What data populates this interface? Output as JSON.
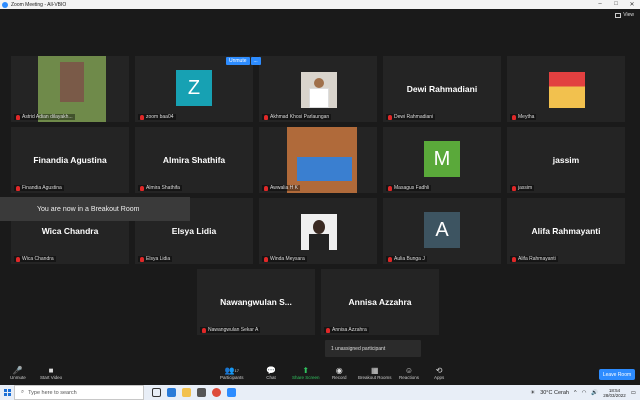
{
  "window": {
    "title": "Zoom Meeting - All-VBIO"
  },
  "view_label": "View",
  "unmute_pill": {
    "label": "Unmute",
    "more": "..."
  },
  "tiles": [
    {
      "id": "astrid",
      "caption": "Astrid Adian dilayakh...",
      "kind": "photo",
      "photo_color": "#6f8a4a"
    },
    {
      "id": "zoom",
      "caption": "zoom baa04",
      "kind": "avatar",
      "letter": "Z",
      "color": "#17a1b3"
    },
    {
      "id": "akhmad",
      "caption": "Akhmad Khosi Parlaungan",
      "kind": "photo",
      "photo_color": "#d9d4cc"
    },
    {
      "id": "dewi",
      "caption": "Dewi Rahmadiani",
      "bigname": "Dewi Rahmadiani",
      "kind": "name"
    },
    {
      "id": "meytha",
      "caption": "Meytha",
      "kind": "photo",
      "photo_color": "#e24040"
    },
    {
      "id": "finandia",
      "caption": "Finandia Agustina",
      "bigname": "Finandia Agustina",
      "kind": "name"
    },
    {
      "id": "almira",
      "caption": "Almira Shathifa",
      "bigname": "Almira Shathifa",
      "kind": "name"
    },
    {
      "id": "awwalia",
      "caption": "Awwalia H K",
      "kind": "photo",
      "photo_color": "#b06a3a"
    },
    {
      "id": "masagus",
      "caption": "Masagus Fadhli",
      "kind": "avatar",
      "letter": "M",
      "color": "#5aa93a"
    },
    {
      "id": "jassim",
      "caption": "jassim",
      "bigname": "jassim",
      "kind": "name"
    },
    {
      "id": "wica",
      "caption": "Wica Chandra",
      "bigname": "Wica Chandra",
      "kind": "name"
    },
    {
      "id": "elsya",
      "caption": "Elsya Lidia",
      "bigname": "Elsya Lidia",
      "kind": "name"
    },
    {
      "id": "winda",
      "caption": "Winda Meysara",
      "kind": "photo",
      "photo_color": "#f0f0f0"
    },
    {
      "id": "aulia",
      "caption": "Aulia Bunga J",
      "kind": "avatar",
      "letter": "A",
      "color": "#3d5461"
    },
    {
      "id": "alifa",
      "caption": "Alifa Rahmayanti",
      "bigname": "Alifa Rahmayanti",
      "kind": "name"
    },
    {
      "id": "nawang",
      "caption": "Nawangwulan Sekar A",
      "bigname": "Nawangwulan  S...",
      "kind": "name"
    },
    {
      "id": "annisa",
      "caption": "Annisa Azzahra",
      "bigname": "Annisa Azzahra",
      "kind": "name"
    }
  ],
  "breakout_banner": "You are now in a Breakout Room",
  "unassigned": "1 unassigned participant",
  "toolbar": {
    "unmute": "Unmute",
    "start_video": "Start Video",
    "participants": "Participants",
    "participants_count": "17",
    "chat": "Chat",
    "share_screen": "Share Screen",
    "record": "Record",
    "breakout_rooms": "Breakout Rooms",
    "reactions": "Reactions",
    "apps": "Apps",
    "leave": "Leave Room"
  },
  "taskbar": {
    "search_placeholder": "Type here to search",
    "weather": "30°C  Cerah",
    "time": "18:54",
    "date": "28/03/2022"
  }
}
